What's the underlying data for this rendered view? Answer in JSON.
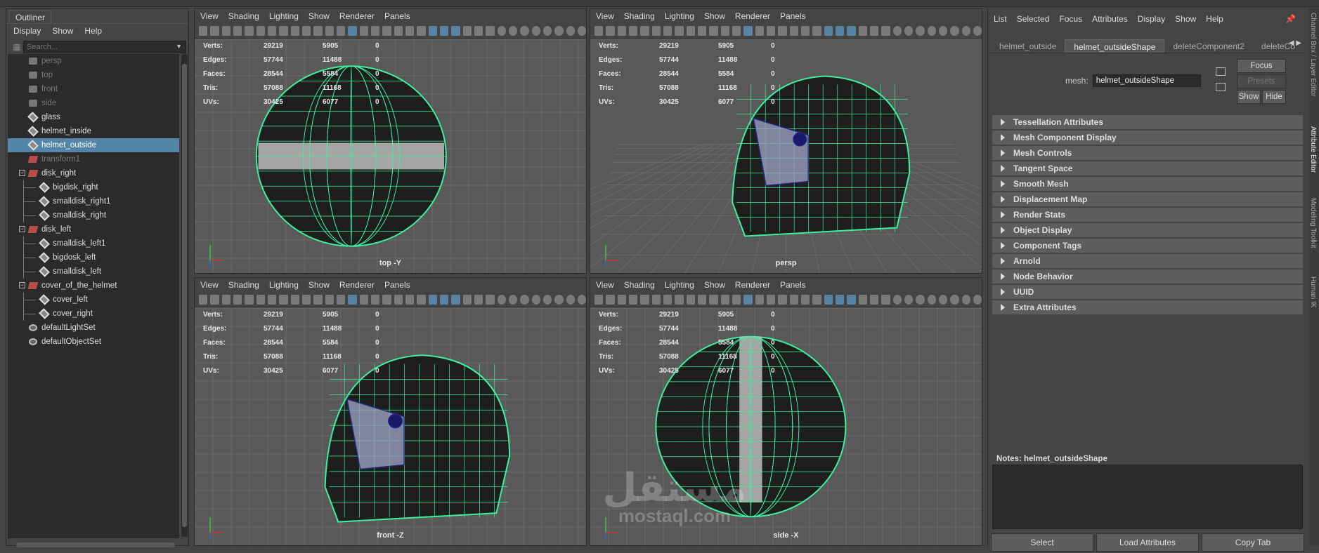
{
  "outliner": {
    "tab": "Outliner",
    "menu": [
      "Display",
      "Show",
      "Help"
    ],
    "search_placeholder": "Search...",
    "items": [
      {
        "label": "persp",
        "type": "camera",
        "dim": true
      },
      {
        "label": "top",
        "type": "camera",
        "dim": true
      },
      {
        "label": "front",
        "type": "camera",
        "dim": true
      },
      {
        "label": "side",
        "type": "camera",
        "dim": true
      },
      {
        "label": "glass",
        "type": "mesh"
      },
      {
        "label": "helmet_inside",
        "type": "mesh"
      },
      {
        "label": "helmet_outside",
        "type": "mesh",
        "selected": true
      },
      {
        "label": "transform1",
        "type": "group",
        "dim": true
      },
      {
        "label": "disk_right",
        "type": "group",
        "expanded": true
      },
      {
        "label": "bigdisk_right",
        "type": "mesh",
        "child": true
      },
      {
        "label": "smalldisk_right1",
        "type": "mesh",
        "child": true
      },
      {
        "label": "smalldisk_right",
        "type": "mesh",
        "child": true
      },
      {
        "label": "disk_left",
        "type": "group",
        "expanded": true
      },
      {
        "label": "smalldisk_left1",
        "type": "mesh",
        "child": true
      },
      {
        "label": "bigdosk_left",
        "type": "mesh",
        "child": true
      },
      {
        "label": "smalldisk_left",
        "type": "mesh",
        "child": true
      },
      {
        "label": "cover_of_the_helmet",
        "type": "group",
        "expanded": true
      },
      {
        "label": "cover_left",
        "type": "mesh",
        "child": true
      },
      {
        "label": "cover_right",
        "type": "mesh",
        "child": true
      },
      {
        "label": "defaultLightSet",
        "type": "set"
      },
      {
        "label": "defaultObjectSet",
        "type": "set"
      }
    ]
  },
  "viewport_menu": [
    "View",
    "Shading",
    "Lighting",
    "Show",
    "Renderer",
    "Panels"
  ],
  "stats": {
    "rows": [
      {
        "label": "Verts:",
        "a": "29219",
        "b": "5905",
        "c": "0"
      },
      {
        "label": "Edges:",
        "a": "57744",
        "b": "11488",
        "c": "0"
      },
      {
        "label": "Faces:",
        "a": "28544",
        "b": "5584",
        "c": "0"
      },
      {
        "label": "Tris:",
        "a": "57088",
        "b": "11168",
        "c": "0"
      },
      {
        "label": "UVs:",
        "a": "30425",
        "b": "6077",
        "c": "0"
      }
    ]
  },
  "viewports": [
    {
      "id": "top",
      "label": "top -Y"
    },
    {
      "id": "persp",
      "label": "persp"
    },
    {
      "id": "front",
      "label": "front -Z"
    },
    {
      "id": "side",
      "label": "side -X"
    }
  ],
  "attribute_editor": {
    "menu": [
      "List",
      "Selected",
      "Focus",
      "Attributes",
      "Display",
      "Show",
      "Help"
    ],
    "tabs": [
      "helmet_outside",
      "helmet_outsideShape",
      "deleteComponent2",
      "deleteCo"
    ],
    "active_tab": "helmet_outsideShape",
    "mesh_label": "mesh:",
    "mesh_value": "helmet_outsideShape",
    "focus_label": "Focus",
    "presets_label": "Presets",
    "show_label": "Show",
    "hide_label": "Hide",
    "sections": [
      "Tessellation Attributes",
      "Mesh Component Display",
      "Mesh Controls",
      "Tangent Space",
      "Smooth Mesh",
      "Displacement Map",
      "Render Stats",
      "Object Display",
      "Component Tags",
      "Arnold",
      "Node Behavior",
      "UUID",
      "Extra Attributes"
    ],
    "notes_label": "Notes:  helmet_outsideShape",
    "buttons": [
      "Select",
      "Load Attributes",
      "Copy Tab"
    ]
  },
  "right_tabs": [
    "Channel Box / Layer Editor",
    "Attribute Editor",
    "Modeling Toolkit",
    "Human IK"
  ],
  "watermark": {
    "arabic": "مستقل",
    "latin": "mostaql.com"
  },
  "colors": {
    "wire": "#3cf0a0",
    "selection": "#5285a6",
    "panel": "#444444",
    "viewport_bg": "#595959"
  }
}
